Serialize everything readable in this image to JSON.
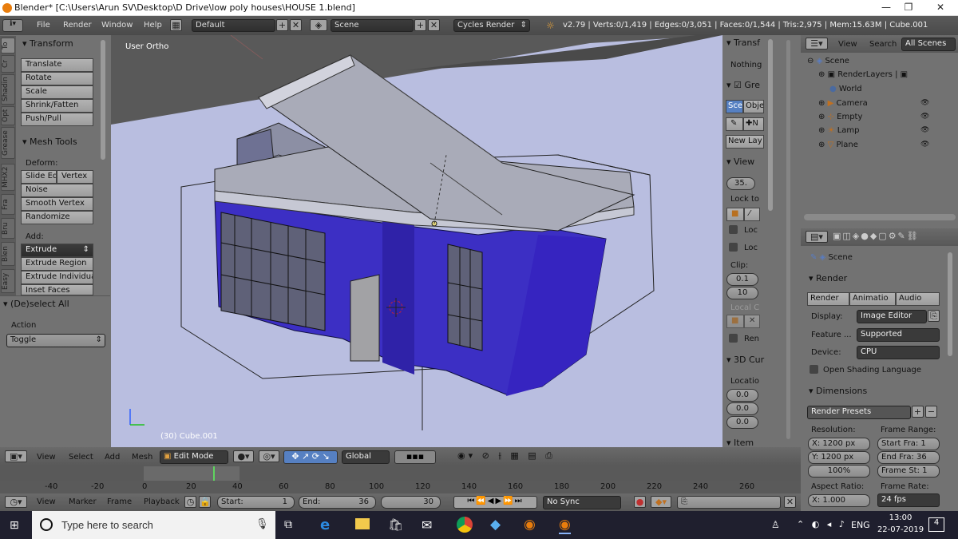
{
  "window": {
    "title": "Blender* [C:\\Users\\Arun SV\\Desktop\\D Drive\\low poly houses\\HOUSE 1.blend]",
    "min": "—",
    "max": "❐",
    "close": "✕"
  },
  "infobar": {
    "menus": [
      "File",
      "Render",
      "Window",
      "Help"
    ],
    "layout": "Default",
    "scene": "Scene",
    "engine": "Cycles Render",
    "stats": "v2.79 | Verts:0/1,419 | Edges:0/3,051 | Faces:0/1,544 | Tris:2,975 | Mem:15.63M | Cube.001"
  },
  "tool_tabs": [
    "To",
    "Cr",
    "Shadin",
    "Opt",
    "Grease",
    "MHX2",
    "Fra",
    "Bru",
    "Blen",
    "Easy"
  ],
  "toolshelf": {
    "transform": {
      "title": "Transform",
      "buttons": [
        "Translate",
        "Rotate",
        "Scale",
        "Shrink/Fatten",
        "Push/Pull"
      ]
    },
    "mesh_tools": {
      "title": "Mesh Tools",
      "deform_label": "Deform:",
      "slide_edge": "Slide Ed",
      "vertex": "Vertex",
      "buttons": [
        "Noise",
        "Smooth Vertex",
        "Randomize"
      ],
      "add_label": "Add:",
      "add_buttons": [
        "Extrude",
        "Extrude Region",
        "Extrude Individual",
        "Inset Faces"
      ]
    },
    "operator": {
      "title": "(De)select All",
      "action_label": "Action",
      "action_value": "Toggle"
    }
  },
  "viewport": {
    "label": "User Ortho",
    "object_label": "(30) Cube.001",
    "colors": {
      "bg": "#b9bee0",
      "wall": "#3c2fc4",
      "roof": "#a9abb8"
    }
  },
  "npanel": {
    "transform_title": "Transf",
    "nothing": "Nothing",
    "grease": "Gre",
    "scene_tab": "Sce",
    "object_tab": "Obje",
    "new_layer": "New Lay",
    "view_title": "View",
    "lens": "35.",
    "lock_to": "Lock to",
    "loc1": "Loc",
    "loc2": "Loc",
    "clip": "Clip:",
    "clip_start": "0.1",
    "clip_end": "10",
    "local_camera": "Local C",
    "render": "Ren",
    "cursor_title": "3D Cur",
    "location": "Locatio",
    "loc_values": [
      "0.0",
      "0.0",
      "0.0"
    ],
    "item": "Item"
  },
  "outliner": {
    "menus": [
      "View",
      "Search"
    ],
    "filter": "All Scenes",
    "items": [
      {
        "label": "Scene",
        "indent": 0
      },
      {
        "label": "RenderLayers",
        "indent": 1
      },
      {
        "label": "World",
        "indent": 1
      },
      {
        "label": "Camera",
        "indent": 1
      },
      {
        "label": "Empty",
        "indent": 1
      },
      {
        "label": "Lamp",
        "indent": 1
      },
      {
        "label": "Plane",
        "indent": 1
      }
    ]
  },
  "properties": {
    "context": "Scene",
    "render_title": "Render",
    "tabs": [
      "Render",
      "Animatio",
      "Audio"
    ],
    "display_label": "Display:",
    "display_value": "Image Editor",
    "feature_label": "Feature ...",
    "feature_value": "Supported",
    "device_label": "Device:",
    "device_value": "CPU",
    "osl": "Open Shading Language",
    "dimensions_title": "Dimensions",
    "presets": "Render Presets",
    "resolution_label": "Resolution:",
    "res_x": "X:  1200 px",
    "res_y": "Y:  1200 px",
    "res_pct": "100%",
    "frame_range_label": "Frame Range:",
    "start_frame": "Start Fra:  1",
    "end_frame": "End Fra:  36",
    "frame_step": "Frame St:  1",
    "aspect_label": "Aspect Ratio:",
    "aspect_x": "X:     1.000",
    "frame_rate_label": "Frame Rate:",
    "fps": "24 fps"
  },
  "view3d_header": {
    "menus": [
      "View",
      "Select",
      "Add",
      "Mesh"
    ],
    "mode": "Edit Mode",
    "orientation": "Global"
  },
  "timeline": {
    "ticks": [
      "-40",
      "-20",
      "0",
      "20",
      "40",
      "60",
      "80",
      "100",
      "120",
      "140",
      "160",
      "180",
      "200",
      "220",
      "240",
      "260"
    ],
    "current_frame": 30
  },
  "timeline_header": {
    "menus": [
      "View",
      "Marker",
      "Frame",
      "Playback"
    ],
    "start": "Start:",
    "start_val": "1",
    "end": "End:",
    "end_val": "36",
    "current": "30",
    "sync": "No Sync"
  },
  "taskbar": {
    "search": "Type here to search",
    "lang": "ENG",
    "time": "13:00",
    "date": "22-07-2019",
    "notif": "4"
  }
}
